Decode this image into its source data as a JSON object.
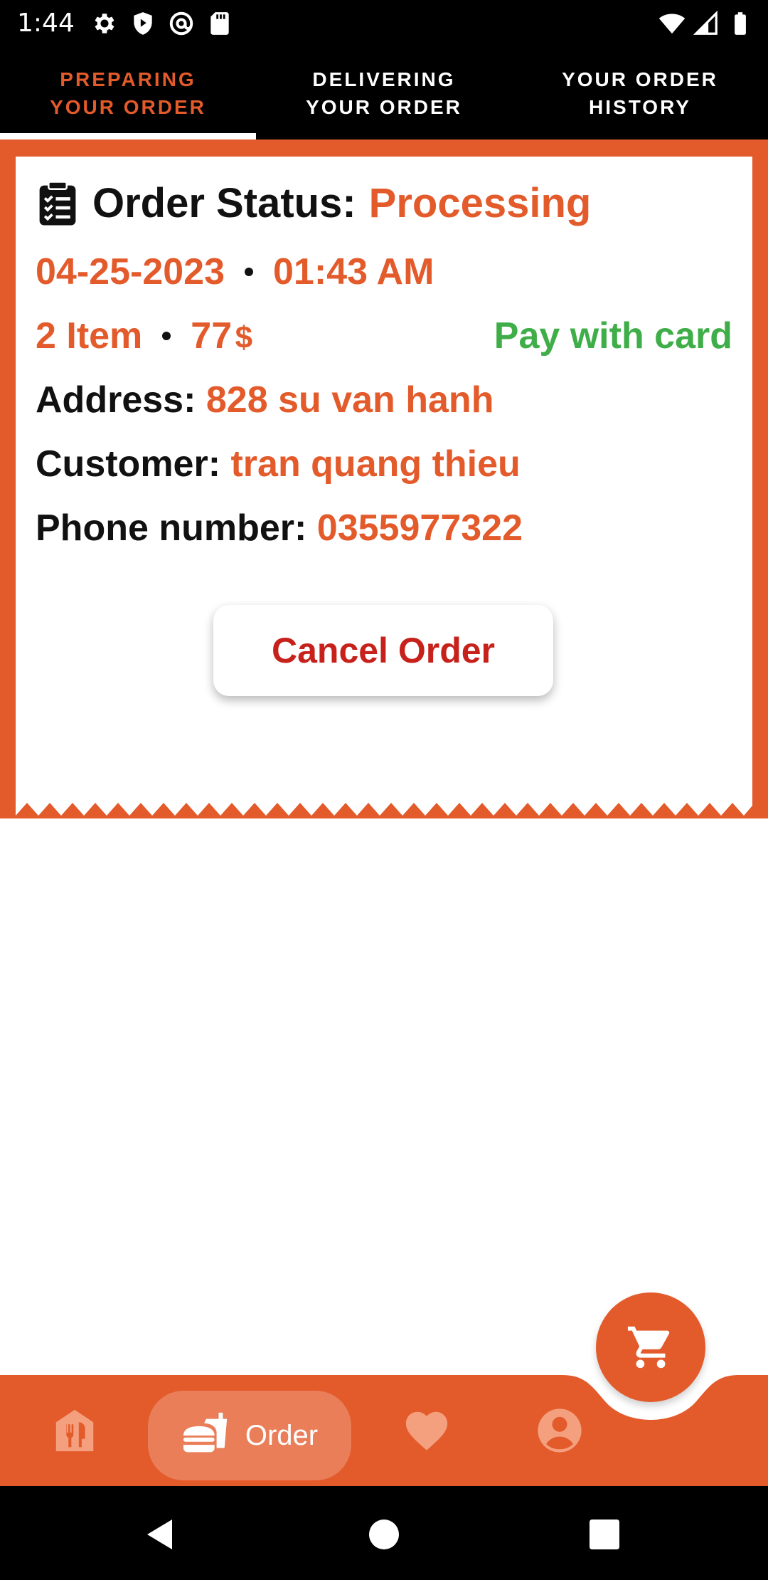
{
  "status_bar": {
    "time": "1:44",
    "left_icons": [
      "gear-icon",
      "shield-play-icon",
      "at-sign-icon",
      "sd-card-icon"
    ],
    "right_icons": [
      "wifi-icon",
      "signal-icon",
      "battery-icon"
    ]
  },
  "tabs": [
    {
      "label": "PREPARING\nYOUR ORDER",
      "active": true
    },
    {
      "label": "DELIVERING\nYOUR ORDER",
      "active": false
    },
    {
      "label": "YOUR ORDER\nHISTORY",
      "active": false
    }
  ],
  "order": {
    "status_label": "Order Status:",
    "status_value": "Processing",
    "date": "04-25-2023",
    "time": "01:43 AM",
    "items": "2 Item",
    "price": "77",
    "currency": "$",
    "payment_method": "Pay with card",
    "address_label": "Address:",
    "address_value": "828 su van hanh",
    "customer_label": "Customer:",
    "customer_value": "tran quang thieu",
    "phone_label": "Phone number:",
    "phone_value": "0355977322",
    "cancel_label": "Cancel Order"
  },
  "bottom_nav": {
    "items": [
      {
        "icon": "restaurant-icon"
      },
      {
        "icon": "burger-drink-icon",
        "label": "Order",
        "active": true
      },
      {
        "icon": "heart-icon"
      },
      {
        "icon": "profile-icon"
      }
    ],
    "fab_icon": "cart-icon"
  },
  "colors": {
    "accent": "#e35a2b",
    "pay_green": "#3fae49",
    "cancel_red": "#c7211b",
    "active_tab": "#e35a2b"
  }
}
